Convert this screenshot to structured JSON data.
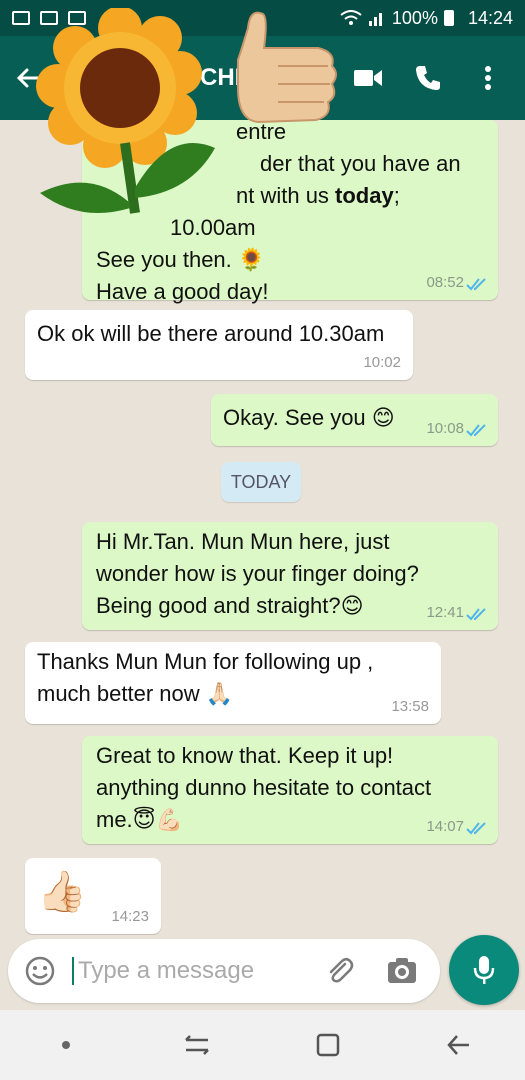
{
  "status_bar": {
    "battery": "100%",
    "time": "14:24"
  },
  "header": {
    "contact_name_fragment": "CHE"
  },
  "messages": [
    {
      "dir": "out",
      "lines": [
        "entre",
        "der that you have an",
        "nt with us ",
        "10.00am",
        "See you then. 🌻",
        "Have a good day!"
      ],
      "bold_word": "today",
      "time": "08:52"
    },
    {
      "dir": "in",
      "text": "Ok ok will be there around 10.30am",
      "time": "10:02"
    },
    {
      "dir": "out",
      "text": "Okay. See you 😊",
      "time": "10:08"
    },
    {
      "dir": "out",
      "lines": [
        "Hi Mr.Tan. Mun Mun here, just",
        "wonder how is your finger doing?",
        "Being good and straight?😊"
      ],
      "time": "12:41"
    },
    {
      "dir": "in",
      "lines": [
        "Thanks Mun Mun for following up ,",
        "much better now 🙏🏻"
      ],
      "time": "13:58"
    },
    {
      "dir": "out",
      "lines": [
        "Great to know that. Keep it up!",
        "anything dunno hesitate to contact",
        "me.😇💪🏻"
      ],
      "time": "14:07"
    },
    {
      "dir": "in",
      "text": "👍🏻",
      "time": "14:23"
    }
  ],
  "date_chip": "TODAY",
  "composer": {
    "placeholder": "Type a message"
  },
  "colors": {
    "header": "#075e54",
    "status": "#054d44",
    "out_bubble": "#dcf8c6",
    "in_bubble": "#ffffff",
    "read_tick": "#4fb6ec",
    "mic": "#0a8a7a"
  },
  "icons": [
    "back-arrow-icon",
    "video-call-icon",
    "phone-icon",
    "more-vert-icon",
    "emoji-icon",
    "attach-icon",
    "camera-icon",
    "mic-icon",
    "sunflower-sticker",
    "thumbs-up-sticker"
  ]
}
